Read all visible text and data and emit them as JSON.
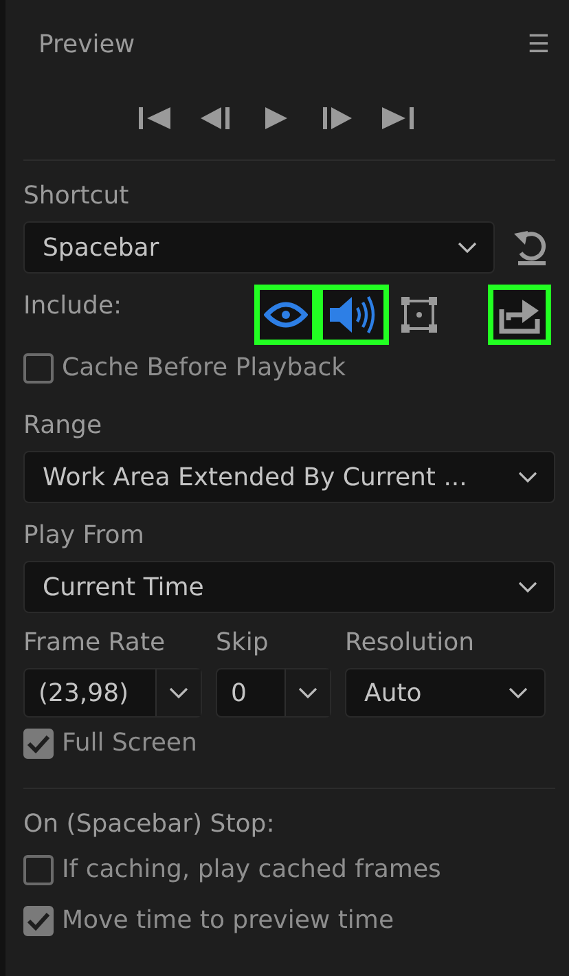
{
  "panel": {
    "title": "Preview",
    "menu_icon": "☰"
  },
  "transport": [
    {
      "kind": "first"
    },
    {
      "kind": "prev"
    },
    {
      "kind": "play"
    },
    {
      "kind": "next"
    },
    {
      "kind": "last"
    }
  ],
  "shortcut": {
    "label": "Shortcut",
    "value": "Spacebar"
  },
  "include": {
    "label": "Include:",
    "toggles": [
      {
        "kind": "video",
        "on": true,
        "highlighted": true
      },
      {
        "kind": "audio",
        "on": true,
        "highlighted": true
      },
      {
        "kind": "overlays",
        "on": false,
        "highlighted": false
      },
      {
        "kind": "layers",
        "on": false,
        "highlighted": true
      }
    ]
  },
  "cache_before_playback": {
    "label": "Cache Before Playback",
    "checked": false
  },
  "range": {
    "label": "Range",
    "value": "Work Area Extended By Current ..."
  },
  "play_from": {
    "label": "Play From",
    "value": "Current Time"
  },
  "frame_rate": {
    "label": "Frame Rate",
    "value": "(23,98)"
  },
  "skip": {
    "label": "Skip",
    "value": "0"
  },
  "resolution": {
    "label": "Resolution",
    "value": "Auto"
  },
  "full_screen": {
    "label": "Full Screen",
    "checked": true
  },
  "on_stop": {
    "label": "On (Spacebar) Stop:",
    "options": [
      {
        "label": "If caching, play cached frames",
        "checked": false
      },
      {
        "label": "Move time to preview time",
        "checked": true
      }
    ]
  }
}
